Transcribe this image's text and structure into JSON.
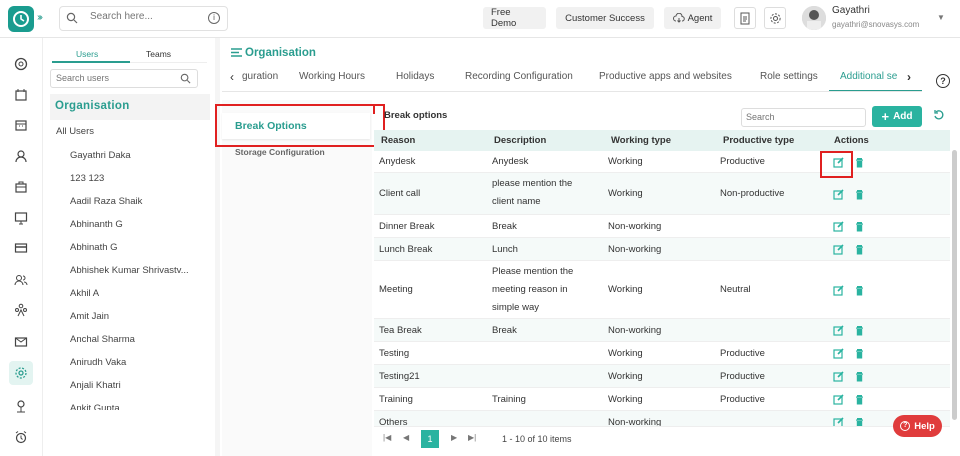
{
  "topbar": {
    "search_placeholder": "Search here...",
    "buttons": [
      "Free Demo",
      "Customer Success",
      "Agent"
    ],
    "user_name": "Gayathri",
    "user_email": "gayathri@snovasys.com"
  },
  "users_panel": {
    "tabs": [
      "Users",
      "Teams"
    ],
    "search_placeholder": "Search users",
    "org_heading": "Organisation",
    "all_users": "All Users",
    "users": [
      "Gayathri Daka",
      "123 123",
      "Aadil Raza Shaik",
      "Abhinanth G",
      "Abhinath G",
      "Abhishek Kumar Shrivastv...",
      "Akhil A",
      "Amit Jain",
      "Anchal Sharma",
      "Anirudh Vaka",
      "Anjali Khatri",
      "Ankit Gupta"
    ]
  },
  "main": {
    "title": "Organisation",
    "tabs": [
      "guration",
      "Working Hours",
      "Holidays",
      "Recording Configuration",
      "Productive apps and websites",
      "Role settings",
      "Additional se"
    ],
    "active_tab": "Additional se"
  },
  "side_menu": {
    "items": [
      "Break Options",
      "Storage Configuration"
    ]
  },
  "break_options": {
    "heading": "Break options",
    "search_placeholder": "Search",
    "add_label": "Add",
    "columns": [
      "Reason",
      "Description",
      "Working type",
      "Productive type",
      "Actions"
    ],
    "rows": [
      {
        "reason": "Anydesk",
        "description": "Anydesk",
        "working": "Working",
        "productive": "Productive"
      },
      {
        "reason": "Client call",
        "description": "please mention the client name",
        "working": "Working",
        "productive": "Non-productive"
      },
      {
        "reason": "Dinner Break",
        "description": "Break",
        "working": "Non-working",
        "productive": ""
      },
      {
        "reason": "Lunch Break",
        "description": "Lunch",
        "working": "Non-working",
        "productive": ""
      },
      {
        "reason": "Meeting",
        "description": "Please mention the meeting reason in simple way",
        "working": "Working",
        "productive": "Neutral"
      },
      {
        "reason": "Tea Break",
        "description": "Break",
        "working": "Non-working",
        "productive": ""
      },
      {
        "reason": "Testing",
        "description": "",
        "working": "Working",
        "productive": "Productive"
      },
      {
        "reason": "Testing21",
        "description": "",
        "working": "Working",
        "productive": "Productive"
      },
      {
        "reason": "Training",
        "description": "Training",
        "working": "Working",
        "productive": "Productive"
      },
      {
        "reason": "Others",
        "description": "",
        "working": "Non-working",
        "productive": ""
      }
    ],
    "pager": {
      "page": "1",
      "info": "1 - 10 of 10 items"
    }
  },
  "help_label": "Help",
  "colors": {
    "accent": "#2ab3a0",
    "highlight": "#e02020"
  }
}
